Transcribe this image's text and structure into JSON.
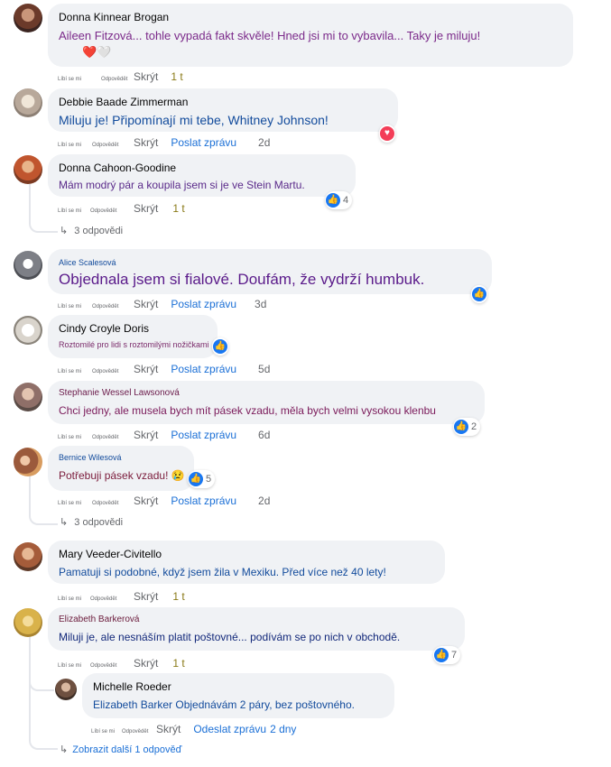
{
  "comments": [
    {
      "author": "Donna Kinnear Brogan",
      "text": "Aileen Fitzová... tohle vypadá fakt skvěle! Hned jsi mi to vybavila... Taky je miluju!",
      "emoji": "❤️🤍",
      "like": "Líbí se mi",
      "reply": "Odpovědět",
      "hide": "Skrýt",
      "time": "1 t"
    },
    {
      "author": "Debbie Baade Zimmerman",
      "text": "Miluju je! Připomínají mi tebe, Whitney Johnson!",
      "like": "Líbí se mi",
      "reply": "Odpovědět",
      "hide": "Skrýt",
      "message": "Poslat zprávu",
      "time": "2d"
    },
    {
      "author": "Donna Cahoon-Goodine",
      "text": "Mám modrý pár a koupila jsem si je ve Stein Martu.",
      "like": "Líbí se mi",
      "reply": "Odpovědět",
      "hide": "Skrýt",
      "time": "1 t",
      "reactions": "4",
      "replies": "3 odpovědi"
    },
    {
      "author": "Alice Scalesová",
      "text": "Objednala jsem si fialové. Doufám, že vydrží humbuk.",
      "like": "Líbí se mi",
      "reply": "Odpovědět",
      "hide": "Skrýt",
      "message": "Poslat zprávu",
      "time": "3d"
    },
    {
      "author": "Cindy Croyle Doris",
      "text": "Roztomilé pro lidi s roztomilými nožičkami",
      "like": "Líbí se mi",
      "reply": "Odpovědět",
      "hide": "Skrýt",
      "message": "Poslat zprávu",
      "time": "5d"
    },
    {
      "author": "Stephanie Wessel Lawsonová",
      "text": "Chci jedny, ale musela bych mít pásek vzadu, měla bych velmi vysokou klenbu",
      "like": "Líbí se mi",
      "reply": "Odpovědět",
      "hide": "Skrýt",
      "message": "Poslat zprávu",
      "time": "6d",
      "reactions": "2"
    },
    {
      "author": "Bernice Wilesová",
      "text": "Potřebuji pásek vzadu! 😢",
      "like": "Líbí se mi",
      "reply": "Odpovědět",
      "hide": "Skrýt",
      "message": "Poslat zprávu",
      "time": "2d",
      "reactions": "5",
      "replies": "3 odpovědi"
    },
    {
      "author": "Mary Veeder-Civitello",
      "text": "Pamatuji si podobné, když jsem žila v Mexiku. Před více než 40 lety!",
      "like": "Líbí se mi",
      "reply": "Odpovědět",
      "hide": "Skrýt",
      "time": "1 t"
    },
    {
      "author": "Elizabeth Barkerová",
      "text": "Miluji je, ale nesnáším platit poštovné... podívám se po nich v obchodě.",
      "like": "Líbí se mi",
      "reply": "Odpovědět",
      "hide": "Skrýt",
      "time": "1 t",
      "reactions": "7"
    },
    {
      "author": "Michelle Roeder",
      "text": "Elizabeth Barker Objednávám 2 páry, bez poštovného.",
      "like": "Líbí se mi",
      "reply": "Odpovědět",
      "hide": "Skrýt",
      "message": "Odeslat zprávu",
      "time": "2 dny"
    }
  ],
  "more_replies": "Zobrazit další 1 odpověď",
  "colors": {
    "accent": "#1877f2",
    "love": "#f33e58",
    "bubble": "#f0f2f5"
  }
}
